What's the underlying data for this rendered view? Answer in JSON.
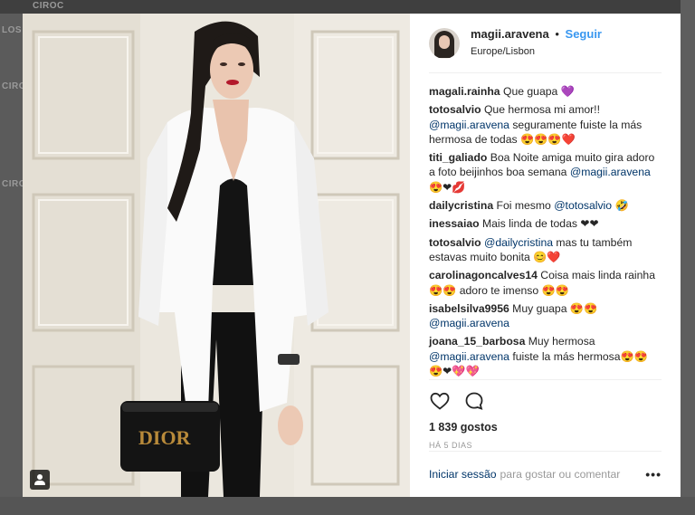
{
  "background": {
    "brand_text": "CIROC",
    "side_texts": [
      "LOS",
      "CIRO",
      "CIRO"
    ]
  },
  "post": {
    "username": "magii.aravena",
    "separator": "•",
    "follow_label": "Seguir",
    "location": "Europe/Lisbon",
    "likes": "1 839 gostos",
    "age": "HÁ 5 DIAS",
    "icons": [
      "heart-icon",
      "comment-icon",
      "more-options-icon",
      "tag-people-icon"
    ]
  },
  "comments": [
    {
      "user": "magali.rainha",
      "parts": [
        {
          "t": "text",
          "v": " Que guapa 💜"
        }
      ]
    },
    {
      "user": "totosalvio",
      "parts": [
        {
          "t": "text",
          "v": " Que hermosa mi amor!! "
        },
        {
          "t": "mention",
          "v": "@magii.aravena"
        },
        {
          "t": "text",
          "v": " seguramente fuiste la más hermosa de todas 😍😍😍❤️"
        }
      ]
    },
    {
      "user": "titi_galiado",
      "parts": [
        {
          "t": "text",
          "v": " Boa Noite amiga muito gira adoro a foto beijinhos boa semana "
        },
        {
          "t": "mention",
          "v": "@magii.aravena"
        },
        {
          "t": "text",
          "v": " 😍❤💋"
        }
      ]
    },
    {
      "user": "dailycristina",
      "parts": [
        {
          "t": "text",
          "v": " Foi mesmo "
        },
        {
          "t": "mention",
          "v": "@totosalvio"
        },
        {
          "t": "text",
          "v": " 🤣"
        }
      ]
    },
    {
      "user": "inessaiao",
      "parts": [
        {
          "t": "text",
          "v": " Mais linda de todas ❤❤"
        }
      ]
    },
    {
      "user": "totosalvio",
      "parts": [
        {
          "t": "text",
          "v": " "
        },
        {
          "t": "mention",
          "v": "@dailycristina"
        },
        {
          "t": "text",
          "v": " mas tu também estavas muito bonita 😊❤️"
        }
      ]
    },
    {
      "user": "carolinagoncalves14",
      "parts": [
        {
          "t": "text",
          "v": " Coisa mais linda rainha 😍😍 adoro te imenso 😍😍"
        }
      ]
    },
    {
      "user": "isabelsilva9956",
      "parts": [
        {
          "t": "text",
          "v": " Muy guapa 😍😍 "
        },
        {
          "t": "mention",
          "v": "@magii.aravena"
        }
      ]
    },
    {
      "user": "joana_15_barbosa",
      "parts": [
        {
          "t": "text",
          "v": " Muy hermosa "
        },
        {
          "t": "mention",
          "v": "@magii.aravena"
        },
        {
          "t": "text",
          "v": " fuiste la más hermosa😍😍😍❤💖💖"
        }
      ]
    }
  ],
  "footer": {
    "login_label": "Iniciar sessão",
    "prompt": "para gostar ou comentar",
    "more_label": "•••"
  },
  "photo": {
    "bag_text": "DIOR"
  }
}
